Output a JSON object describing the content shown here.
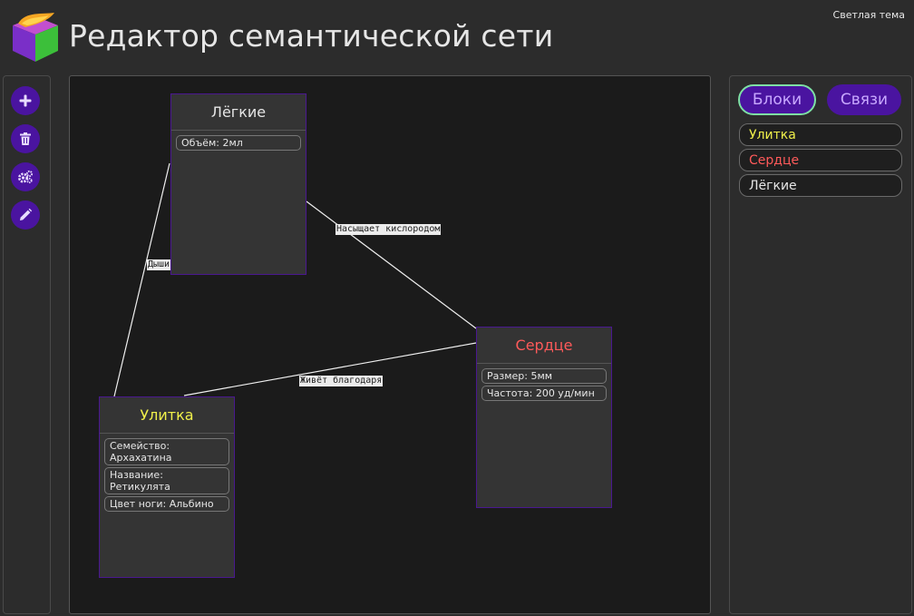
{
  "header": {
    "title": "Редактор семантической сети",
    "theme_toggle": "Светлая тема"
  },
  "toolbar": {
    "buttons": [
      {
        "name": "add",
        "icon": "plus-icon"
      },
      {
        "name": "delete",
        "icon": "trash-icon"
      },
      {
        "name": "settings",
        "icon": "gears-icon"
      },
      {
        "name": "edit",
        "icon": "pencil-icon"
      }
    ]
  },
  "nodes": [
    {
      "title": "Лёгкие",
      "color": "#e6e6e6",
      "props": [
        "Объём: 2мл"
      ]
    },
    {
      "title": "Сердце",
      "color": "#ff5a5a",
      "props": [
        "Размер: 5мм",
        "Частота: 200 уд/мин"
      ]
    },
    {
      "title": "Улитка",
      "color": "#f0f04a",
      "props": [
        "Семейство: Архахатина",
        "Название: Ретикулята",
        "Цвет ноги: Альбино"
      ]
    }
  ],
  "edges": [
    {
      "label": "Насыщает кислородом"
    },
    {
      "label": "Живёт благодаря"
    },
    {
      "label": "Дыши"
    }
  ],
  "side_panel": {
    "tabs": [
      {
        "label": "Блоки",
        "active": true
      },
      {
        "label": "Связи",
        "active": false
      }
    ],
    "items": [
      {
        "label": "Улитка",
        "color": "#f0f04a"
      },
      {
        "label": "Сердце",
        "color": "#ff5a5a"
      },
      {
        "label": "Лёгкие",
        "color": "#e6e6e6"
      }
    ]
  },
  "colors": {
    "accent": "#4a14a0",
    "active_tab_border": "#7ee0a4",
    "node_border": "#4a1890",
    "canvas_bg": "#1b1b1b"
  }
}
